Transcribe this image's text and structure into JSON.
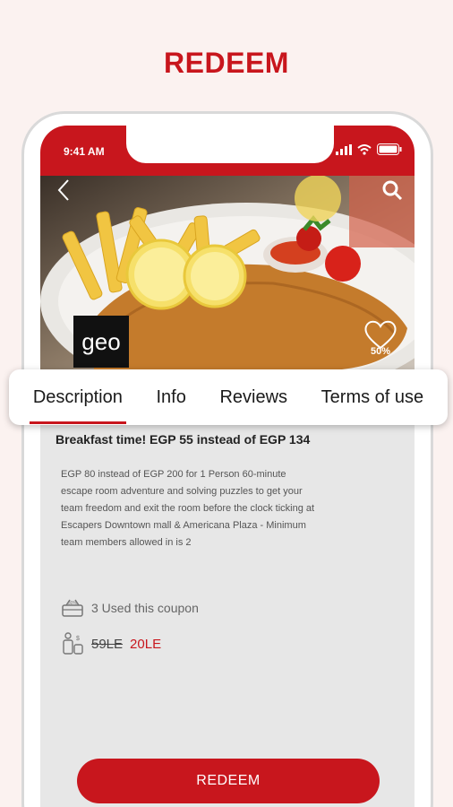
{
  "header": {
    "title": "REDEEM"
  },
  "status_bar": {
    "time": "9:41 AM"
  },
  "merchant": {
    "logo_text": "geo"
  },
  "favorite": {
    "discount": "50%"
  },
  "tabs": [
    {
      "label": "Description",
      "active": true
    },
    {
      "label": "Info",
      "active": false
    },
    {
      "label": "Reviews",
      "active": false
    },
    {
      "label": "Terms of use",
      "active": false
    }
  ],
  "offer": {
    "title": "Breakfast time! EGP 55 instead of EGP 134",
    "description": "EGP 80 instead of EGP 200 for 1 Person 60-minute escape room adventure and solving puzzles to get your team freedom and exit the room before the clock ticking at Escapers Downtown mall & Americana Plaza - Minimum team members allowed in is 2",
    "used_text": "3 Used this coupon",
    "old_price": "59LE",
    "new_price": "20LE"
  },
  "actions": {
    "redeem_label": "REDEEM"
  },
  "colors": {
    "accent": "#c8161d",
    "background": "#fbf2f0"
  },
  "icons": [
    "back-icon",
    "search-icon",
    "signal-icon",
    "wifi-icon",
    "battery-icon",
    "heart-icon",
    "basket-icon",
    "money-icon"
  ]
}
